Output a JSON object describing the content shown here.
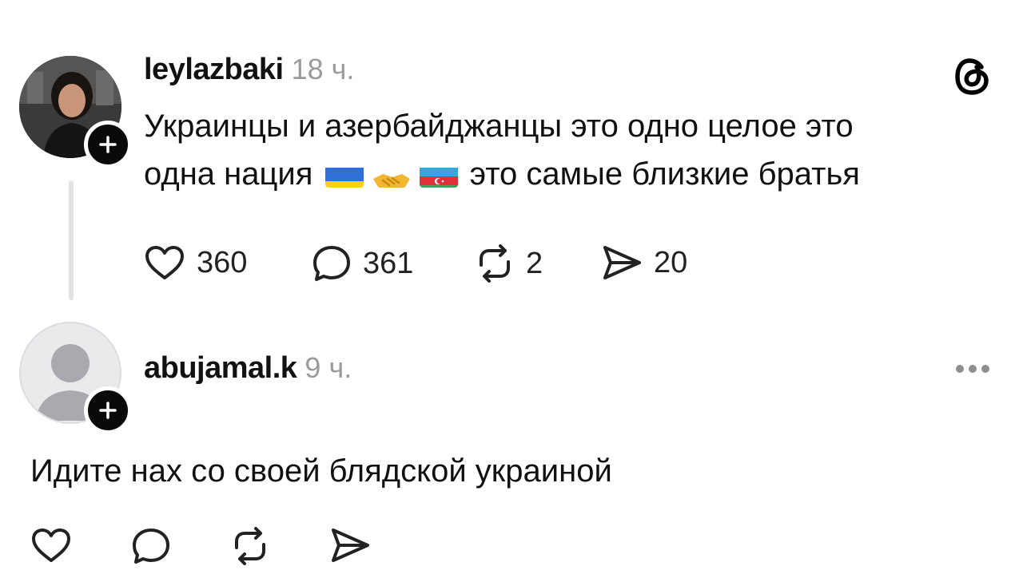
{
  "post1": {
    "username": "leylazbaki",
    "time": "18 ч.",
    "text_line1": "Украинцы и азербайджанцы это одно целое это",
    "text_line2_a": "одна нация",
    "text_line2_b": "это самые близкие братья",
    "emojis": [
      "ukraine-flag",
      "handshake",
      "azerbaijan-flag"
    ],
    "likes": "360",
    "comments": "361",
    "reposts": "2",
    "shares": "20"
  },
  "post2": {
    "username": "abujamal.k",
    "time": "9 ч.",
    "text": "Идите нах со своей блядской украиной"
  },
  "colors": {
    "text": "#111111",
    "muted": "#9b9b9b",
    "thread_line": "#e3e3e3"
  }
}
